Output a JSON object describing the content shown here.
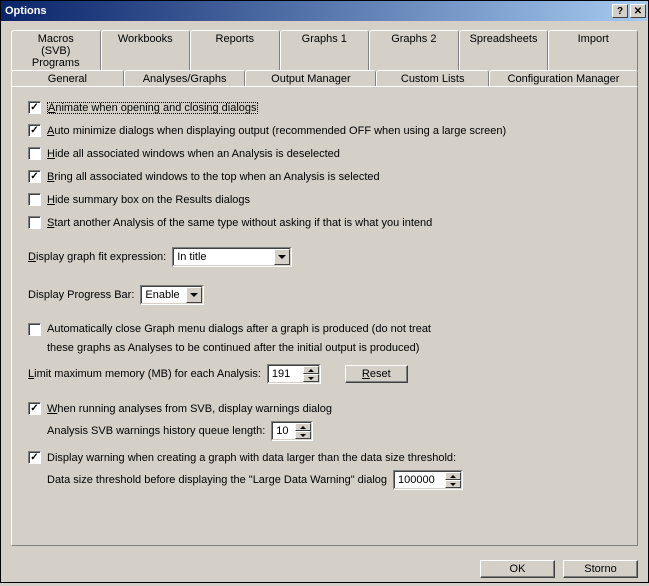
{
  "window": {
    "title": "Options"
  },
  "tabs_top": [
    "Macros (SVB) Programs",
    "Workbooks",
    "Reports",
    "Graphs 1",
    "Graphs 2",
    "Spreadsheets",
    "Import"
  ],
  "tabs_bottom": [
    "General",
    "Analyses/Graphs",
    "Output Manager",
    "Custom Lists",
    "Configuration Manager"
  ],
  "opts": {
    "animate": {
      "label_pre": "",
      "u": "A",
      "label": "nimate when opening and closing dialogs",
      "checked": true,
      "focused": true
    },
    "automin": {
      "u": "A",
      "label": "uto minimize dialogs when displaying output (recommended OFF when using a large screen)",
      "checked": true
    },
    "hideassoc": {
      "u": "H",
      "label": "ide all associated windows when an Analysis is deselected",
      "checked": false
    },
    "bringtop": {
      "u": "B",
      "label": "ring all associated windows to the top when an Analysis is selected",
      "checked": true
    },
    "hidesummary": {
      "u": "H",
      "label": "ide summary box on the Results dialogs",
      "checked": false
    },
    "startanother": {
      "u": "S",
      "label": "tart another Analysis of the same type without asking if that is what you intend",
      "checked": false
    },
    "autoclose": {
      "label": "Automatically close Graph menu dialogs after a graph is produced (do not treat",
      "line2": "these graphs as Analyses to be continued after the initial output is produced)",
      "checked": false
    },
    "svbwarn": {
      "u": "W",
      "label": "hen running analyses from SVB, display warnings dialog",
      "checked": true
    },
    "dispwarn": {
      "label": "Display warning when creating a graph with data larger than the data size threshold:",
      "checked": true
    }
  },
  "fields": {
    "fitexpr": {
      "pre": "",
      "u": "D",
      "label": "isplay graph fit expression:",
      "value": "In title"
    },
    "progbar": {
      "label": "Display Progress Bar:",
      "value": "Enable"
    },
    "maxmem": {
      "pre": "",
      "u": "L",
      "label": "imit maximum memory (MB) for each Analysis:",
      "value": "191"
    },
    "reset": {
      "u": "R",
      "label": "eset"
    },
    "queuelen": {
      "label": "Analysis SVB warnings history queue length:",
      "value": "10"
    },
    "threshold": {
      "label": "Data size threshold before displaying the \"Large Data Warning\" dialog",
      "value": "100000"
    }
  },
  "buttons": {
    "ok": "OK",
    "cancel": "Storno"
  }
}
